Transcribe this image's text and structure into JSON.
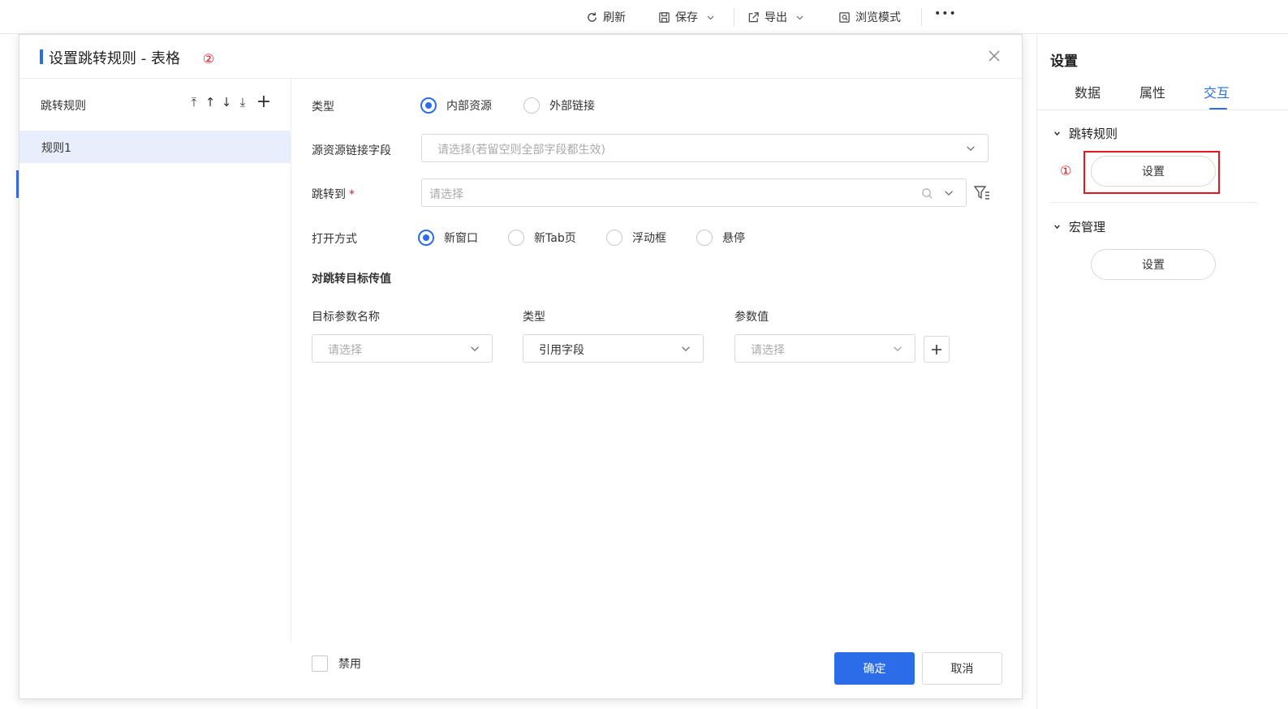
{
  "toolbar": {
    "refresh_label": "刷新",
    "save_label": "保存",
    "export_label": "导出",
    "browse_mode_label": "浏览模式",
    "more_label": "•••"
  },
  "right_panel": {
    "title": "设置",
    "tabs": [
      {
        "label": "数据"
      },
      {
        "label": "属性"
      },
      {
        "label": "交互",
        "active": true
      }
    ],
    "sections": [
      {
        "label": "跳转规则",
        "button_label": "设置"
      },
      {
        "label": "宏管理",
        "button_label": "设置"
      }
    ],
    "marker_1": "①",
    "highlight_color": "#e5161d"
  },
  "dialog": {
    "title": "设置跳转规则 - 表格",
    "marker_2": "②",
    "left": {
      "header": "跳转规则",
      "tools": [
        "⤒",
        "↑",
        "↓",
        "⤓",
        "+"
      ],
      "rules": [
        {
          "label": "规则1",
          "selected": true
        }
      ]
    },
    "form": {
      "type_label": "类型",
      "type_options": [
        {
          "label": "内部资源",
          "checked": true
        },
        {
          "label": "外部链接",
          "checked": false
        }
      ],
      "source_field_label": "源资源链接字段",
      "source_field_placeholder": "请选择(若留空则全部字段都生效)",
      "jump_to_label": "跳转到",
      "jump_to_required": "*",
      "jump_to_placeholder": "请选择",
      "open_mode_label": "打开方式",
      "open_mode_options": [
        {
          "label": "新窗口",
          "checked": true
        },
        {
          "label": "新Tab页",
          "checked": false
        },
        {
          "label": "浮动框",
          "checked": false
        },
        {
          "label": "悬停",
          "checked": false
        }
      ],
      "pass_value_heading": "对跳转目标传值",
      "param_columns": {
        "target_param_name": "目标参数名称",
        "type": "类型",
        "param_value": "参数值"
      },
      "param_row": {
        "target_param_placeholder": "请选择",
        "type_value": "引用字段",
        "param_value_placeholder": "请选择"
      },
      "disable_label": "禁用"
    },
    "ok_label": "确定",
    "cancel_label": "取消",
    "accent_color": "#2b6de8"
  }
}
